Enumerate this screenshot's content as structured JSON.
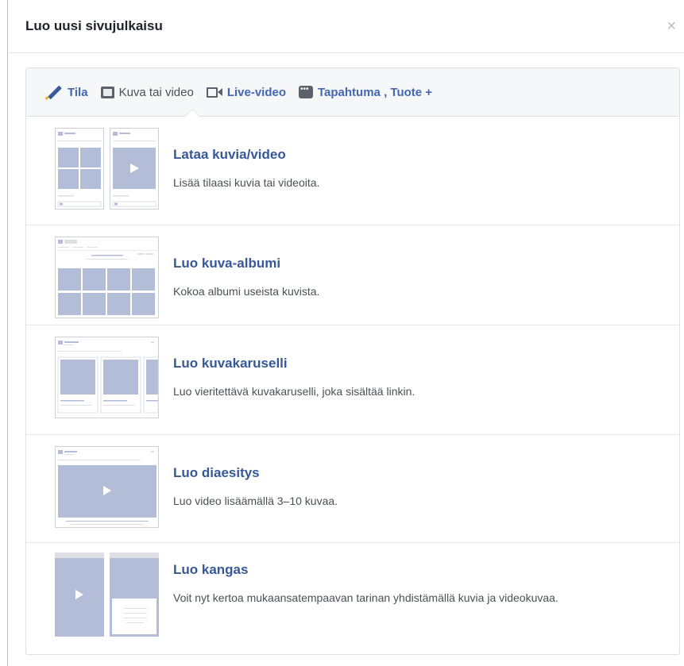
{
  "dialog": {
    "title": "Luo uusi sivujulkaisu",
    "close_symbol": "×"
  },
  "tabs": [
    {
      "label": "Tila",
      "icon": "pencil-icon"
    },
    {
      "label": "Kuva tai video",
      "icon": "photo-icon",
      "active": true
    },
    {
      "label": "Live-video",
      "icon": "live-video-icon"
    },
    {
      "label": "Tapahtuma , Tuote +",
      "icon": "more-icon"
    }
  ],
  "options": [
    {
      "title": "Lataa kuvia/video",
      "desc": "Lisää tilaasi kuvia tai videoita."
    },
    {
      "title": "Luo kuva-albumi",
      "desc": "Kokoa albumi useista kuvista."
    },
    {
      "title": "Luo kuvakaruselli",
      "desc": "Luo vieritettävä kuvakaruselli, joka sisältää linkin."
    },
    {
      "title": "Luo diaesitys",
      "desc": "Luo video lisäämällä 3–10 kuvaa."
    },
    {
      "title": "Luo kangas",
      "desc": "Voit nyt kertoa mukaansatempaavan tarinan yhdistämällä kuvia ja videokuvaa."
    }
  ],
  "colors": {
    "link": "#365899",
    "tab_link": "#4267b2",
    "placeholder": "#b4bdd8"
  }
}
